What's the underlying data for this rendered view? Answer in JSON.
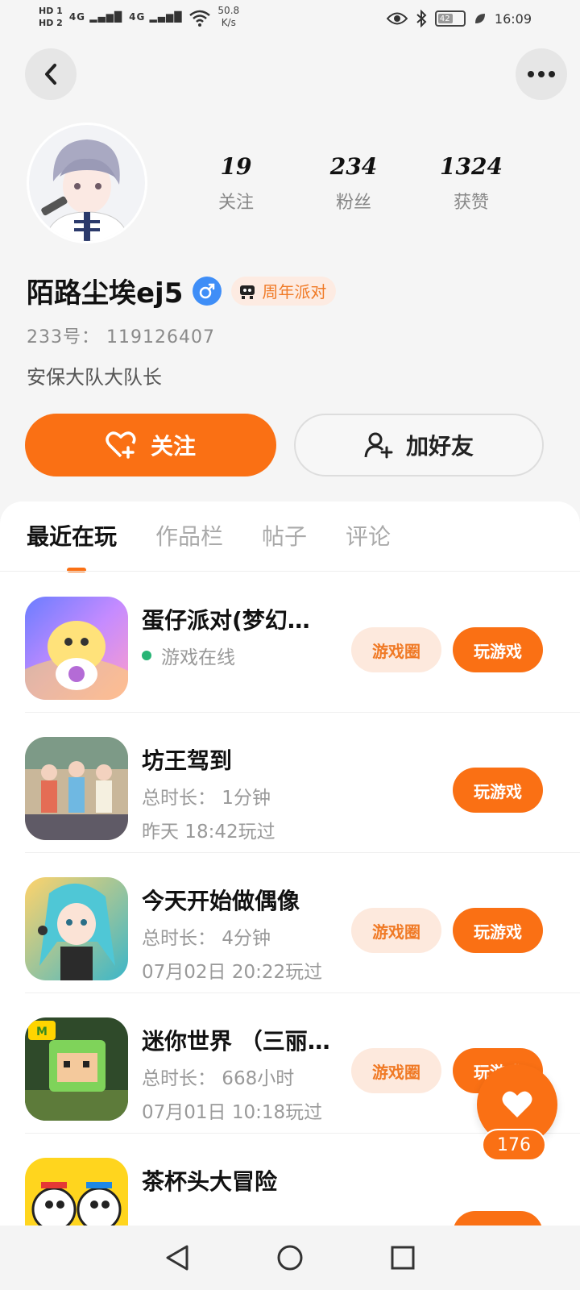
{
  "status_bar": {
    "hd1": "HD 1",
    "hd2": "HD 2",
    "signal1": "4G",
    "signal2": "4G",
    "speed_value": "50.8",
    "speed_unit": "K/s",
    "battery": "42",
    "time": "16:09"
  },
  "profile": {
    "stats": [
      {
        "value": "19",
        "label": "关注"
      },
      {
        "value": "234",
        "label": "粉丝"
      },
      {
        "value": "1324",
        "label": "获赞"
      }
    ],
    "name": "陌路尘埃ej5",
    "badge": "周年派对",
    "uid": "233号：  119126407",
    "bio": "安保大队大队长",
    "follow_label": "关注",
    "add_friend_label": "加好友"
  },
  "tabs": [
    {
      "label": "最近在玩",
      "active": true
    },
    {
      "label": "作品栏",
      "active": false
    },
    {
      "label": "帖子",
      "active": false
    },
    {
      "label": "评论",
      "active": false
    }
  ],
  "games": [
    {
      "title": "蛋仔派对(梦幻…",
      "line2": "游戏在线",
      "line3": "",
      "online": true,
      "circle": "游戏圈",
      "play": "玩游戏"
    },
    {
      "title": "坊王驾到",
      "line2": "总时长：  1分钟",
      "line3": "昨天  18:42玩过",
      "online": false,
      "circle": "",
      "play": "玩游戏"
    },
    {
      "title": "今天开始做偶像",
      "line2": "总时长：  4分钟",
      "line3": "07月02日  20:22玩过",
      "online": false,
      "circle": "游戏圈",
      "play": "玩游戏"
    },
    {
      "title": "迷你世界 （三丽…",
      "line2": "总时长：  668小时",
      "line3": "07月01日  10:18玩过",
      "online": false,
      "circle": "游戏圈",
      "play": "玩游戏"
    },
    {
      "title": "茶杯头大冒险",
      "line2": "",
      "line3": "",
      "online": false,
      "circle": "",
      "play": ""
    }
  ],
  "floating_like": {
    "count": "176"
  },
  "colors": {
    "accent": "#fa7014",
    "online": "#27b475",
    "gender": "#3f8ef7"
  }
}
